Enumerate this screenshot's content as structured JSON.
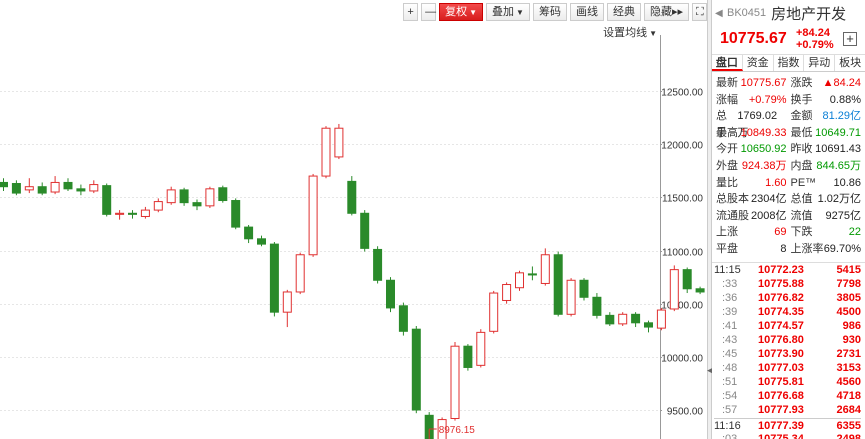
{
  "toolbar": {
    "plus": "+",
    "minus": "—",
    "fuquan": "复权",
    "diejia": "叠加",
    "choumaa": "筹码",
    "huaxian": "画线",
    "jingdian": "经典",
    "yincang": "隐藏",
    "more": "▸▸",
    "grid": "⛶"
  },
  "ma_setting": "设置均线",
  "chart_data": {
    "type": "candlestick",
    "yticks": [
      12500,
      12000,
      11500,
      11000,
      10500,
      10000,
      9500
    ],
    "ytick_labels": [
      "12500.00",
      "12000.00",
      "11500.00",
      "11000.00",
      "10500.00",
      "10000.00",
      "9500.00"
    ],
    "ylim": [
      8900,
      12950
    ],
    "min_label": "8976.15",
    "min_value": 8976.15,
    "min_index": 39,
    "candles": [
      [
        11640,
        11600,
        11680,
        11560
      ],
      [
        11630,
        11540,
        11660,
        11520
      ],
      [
        11570,
        11600,
        11680,
        11540
      ],
      [
        11600,
        11540,
        11640,
        11520
      ],
      [
        11550,
        11640,
        11700,
        11530
      ],
      [
        11640,
        11580,
        11680,
        11560
      ],
      [
        11580,
        11560,
        11620,
        11520
      ],
      [
        11560,
        11620,
        11660,
        11540
      ],
      [
        11610,
        11340,
        11630,
        11320
      ],
      [
        11340,
        11350,
        11380,
        11290
      ],
      [
        11350,
        11340,
        11380,
        11300
      ],
      [
        11320,
        11380,
        11410,
        11300
      ],
      [
        11380,
        11460,
        11490,
        11360
      ],
      [
        11450,
        11570,
        11600,
        11430
      ],
      [
        11570,
        11450,
        11590,
        11420
      ],
      [
        11450,
        11420,
        11480,
        11380
      ],
      [
        11420,
        11580,
        11600,
        11400
      ],
      [
        11590,
        11470,
        11610,
        11450
      ],
      [
        11470,
        11220,
        11490,
        11200
      ],
      [
        11220,
        11110,
        11240,
        11070
      ],
      [
        11110,
        11060,
        11140,
        11040
      ],
      [
        11060,
        10420,
        11080,
        10380
      ],
      [
        10420,
        10610,
        10630,
        10280
      ],
      [
        10610,
        10960,
        10980,
        10590
      ],
      [
        10960,
        11700,
        11720,
        10940
      ],
      [
        11700,
        12150,
        12170,
        11680
      ],
      [
        11880,
        12150,
        12190,
        11860
      ],
      [
        11650,
        11350,
        11700,
        11330
      ],
      [
        11350,
        11020,
        11380,
        10990
      ],
      [
        11010,
        10720,
        11040,
        10690
      ],
      [
        10720,
        10460,
        10750,
        10420
      ],
      [
        10480,
        10240,
        10510,
        10200
      ],
      [
        10260,
        9500,
        10290,
        9470
      ],
      [
        9450,
        9130,
        9480,
        8976
      ],
      [
        9180,
        9410,
        9430,
        9150
      ],
      [
        9420,
        10100,
        10140,
        9400
      ],
      [
        10100,
        9900,
        10120,
        9870
      ],
      [
        9920,
        10230,
        10260,
        9900
      ],
      [
        10240,
        10600,
        10620,
        10220
      ],
      [
        10530,
        10680,
        10700,
        10500
      ],
      [
        10650,
        10790,
        10810,
        10620
      ]
    ],
    "candles2": [
      [
        10780,
        10770,
        10850,
        10720
      ],
      [
        10690,
        10960,
        11020,
        10670
      ],
      [
        10960,
        10400,
        10990,
        10380
      ],
      [
        10400,
        10720,
        10740,
        10380
      ],
      [
        10720,
        10560,
        10740,
        10530
      ],
      [
        10560,
        10390,
        10600,
        10360
      ],
      [
        10390,
        10310,
        10420,
        10290
      ],
      [
        10310,
        10400,
        10420,
        10290
      ],
      [
        10400,
        10320,
        10420,
        10280
      ],
      [
        10320,
        10280,
        10340,
        10230
      ],
      [
        10270,
        10440,
        10460,
        10250
      ],
      [
        10450,
        10820,
        10860,
        10430
      ],
      [
        10820,
        10640,
        10840,
        10600
      ],
      [
        10640,
        10610,
        10660,
        10590
      ],
      [
        10610,
        10740,
        10760,
        10600
      ],
      [
        10740,
        10760,
        10780,
        10700
      ],
      [
        10760,
        10720,
        10780,
        10690
      ],
      [
        10720,
        10700,
        10800,
        10680
      ],
      [
        10700,
        10860,
        10890,
        10680
      ],
      [
        10780,
        10690,
        10800,
        10660
      ],
      [
        10690,
        10700,
        10800,
        10640
      ],
      [
        10690,
        10775,
        10849,
        10649
      ]
    ]
  },
  "panel": {
    "arrow": "◀",
    "code": "BK0451",
    "name": "房地产开发",
    "price": "10775.67",
    "change": "+84.24",
    "change_pct": "+0.79%",
    "add": "+",
    "tabs": [
      "盘口",
      "资金",
      "指数",
      "异动",
      "板块"
    ],
    "stats": [
      [
        {
          "l": "最新",
          "v": "10775.67",
          "c": "red"
        },
        {
          "l": "涨跌",
          "v": "▲84.24",
          "c": "red"
        }
      ],
      [
        {
          "l": "涨幅",
          "v": "+0.79%",
          "c": "red"
        },
        {
          "l": "换手",
          "v": "0.88%",
          "c": "black"
        }
      ],
      [
        {
          "l": "总手",
          "v": "1769.02万",
          "c": "black"
        },
        {
          "l": "金额",
          "v": "81.29亿",
          "c": "blue"
        }
      ],
      [
        {
          "l": "最高",
          "v": "10849.33",
          "c": "red"
        },
        {
          "l": "最低",
          "v": "10649.71",
          "c": "green"
        }
      ],
      [
        {
          "l": "今开",
          "v": "10650.92",
          "c": "green"
        },
        {
          "l": "昨收",
          "v": "10691.43",
          "c": "black"
        }
      ],
      [
        {
          "l": "外盘",
          "v": "924.38万",
          "c": "red"
        },
        {
          "l": "内盘",
          "v": "844.65万",
          "c": "green"
        }
      ],
      [
        {
          "l": "量比",
          "v": "1.60",
          "c": "red"
        },
        {
          "l": "PE™",
          "v": "10.86",
          "c": "black"
        }
      ],
      [
        {
          "l": "总股本",
          "v": "2304亿",
          "c": "black"
        },
        {
          "l": "总值",
          "v": "1.02万亿",
          "c": "black"
        }
      ],
      [
        {
          "l": "流通股",
          "v": "2008亿",
          "c": "black"
        },
        {
          "l": "流值",
          "v": "9275亿",
          "c": "black"
        }
      ],
      [
        {
          "l": "上涨",
          "v": "69",
          "c": "red"
        },
        {
          "l": "下跌",
          "v": "22",
          "c": "green"
        }
      ],
      [
        {
          "l": "平盘",
          "v": "8",
          "c": "black"
        },
        {
          "l": "上涨率",
          "v": "69.70%",
          "c": "black"
        }
      ]
    ],
    "ticks": [
      {
        "t": "11:15",
        "p": "10772.23",
        "v": "5415",
        "full": true
      },
      {
        "t": ":33",
        "p": "10775.88",
        "v": "7798"
      },
      {
        "t": ":36",
        "p": "10776.82",
        "v": "3805"
      },
      {
        "t": ":39",
        "p": "10774.35",
        "v": "4500"
      },
      {
        "t": ":41",
        "p": "10774.57",
        "v": "986"
      },
      {
        "t": ":43",
        "p": "10776.80",
        "v": "930"
      },
      {
        "t": ":45",
        "p": "10773.90",
        "v": "2731"
      },
      {
        "t": ":48",
        "p": "10777.03",
        "v": "3153"
      },
      {
        "t": ":51",
        "p": "10775.81",
        "v": "4560"
      },
      {
        "t": ":54",
        "p": "10776.68",
        "v": "4718"
      },
      {
        "t": ":57",
        "p": "10777.93",
        "v": "2684"
      },
      {
        "t": "11:16",
        "p": "10777.39",
        "v": "6355",
        "full": true,
        "new": true
      },
      {
        "t": ":03",
        "p": "10775.34",
        "v": "2498"
      }
    ]
  }
}
